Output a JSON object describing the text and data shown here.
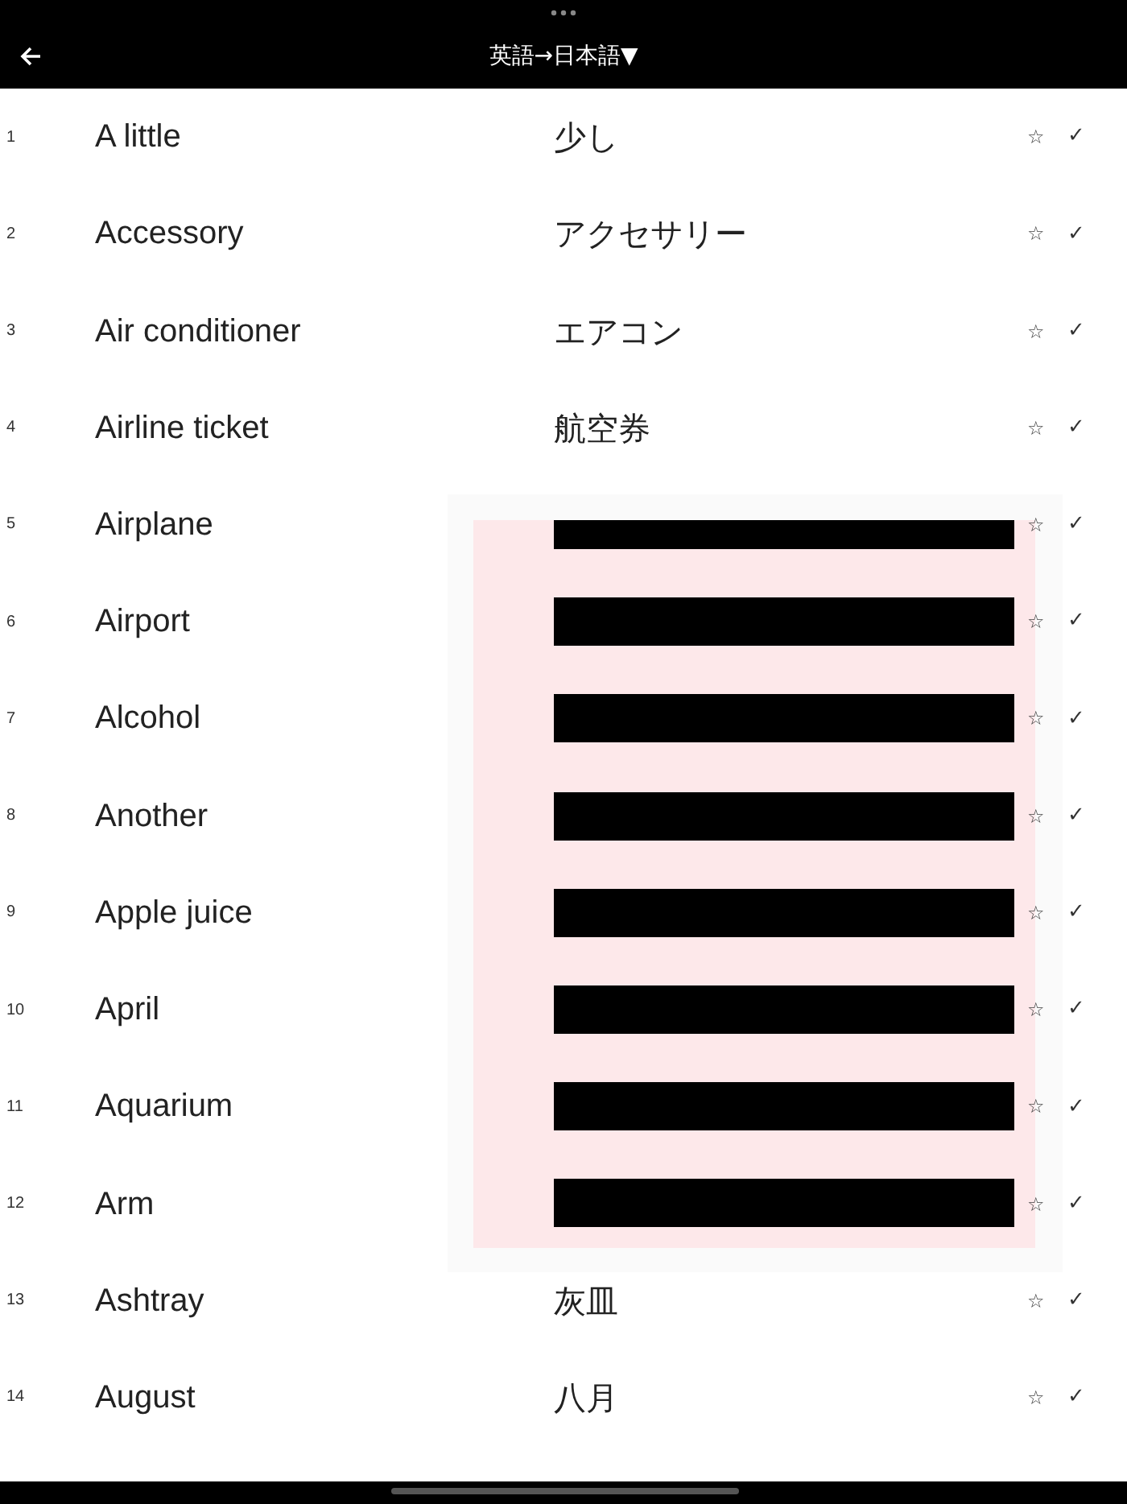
{
  "header": {
    "title": "英語→日本語▼"
  },
  "rows": [
    {
      "kind": "plain",
      "number": "1",
      "english": "A little",
      "japanese": "少し",
      "star": "☆",
      "check": "✓"
    },
    {
      "kind": "plain",
      "number": "2",
      "english": "Accessory",
      "japanese": "アクセサリー",
      "star": "☆",
      "check": "✓"
    },
    {
      "kind": "plain",
      "number": "3",
      "english": "Air conditioner",
      "japanese": "エアコン",
      "star": "☆",
      "check": "✓"
    },
    {
      "kind": "plain",
      "number": "4",
      "english": "Airline ticket",
      "japanese": "航空券",
      "star": "☆",
      "check": "✓"
    },
    {
      "kind": "cut",
      "number": "5",
      "english": "Airplane",
      "star": "☆",
      "check": "✓"
    },
    {
      "kind": "covered",
      "number": "6",
      "english": "Airport",
      "star": "☆",
      "check": "✓"
    },
    {
      "kind": "covered",
      "number": "7",
      "english": "Alcohol",
      "star": "☆",
      "check": "✓"
    },
    {
      "kind": "covered",
      "number": "8",
      "english": "Another",
      "star": "☆",
      "check": "✓"
    },
    {
      "kind": "covered",
      "number": "9",
      "english": "Apple juice",
      "star": "☆",
      "check": "✓"
    },
    {
      "kind": "covered",
      "number": "10",
      "english": "April",
      "star": "☆",
      "check": "✓"
    },
    {
      "kind": "covered",
      "number": "11",
      "english": "Aquarium",
      "star": "☆",
      "check": "✓"
    },
    {
      "kind": "covered",
      "number": "12",
      "english": "Arm",
      "star": "☆",
      "check": "✓"
    },
    {
      "kind": "plain",
      "number": "13",
      "english": "Ashtray",
      "japanese": "灰皿",
      "star": "☆",
      "check": "✓"
    },
    {
      "kind": "plain",
      "number": "14",
      "english": "August",
      "japanese": "八月",
      "star": "☆",
      "check": "✓"
    }
  ]
}
